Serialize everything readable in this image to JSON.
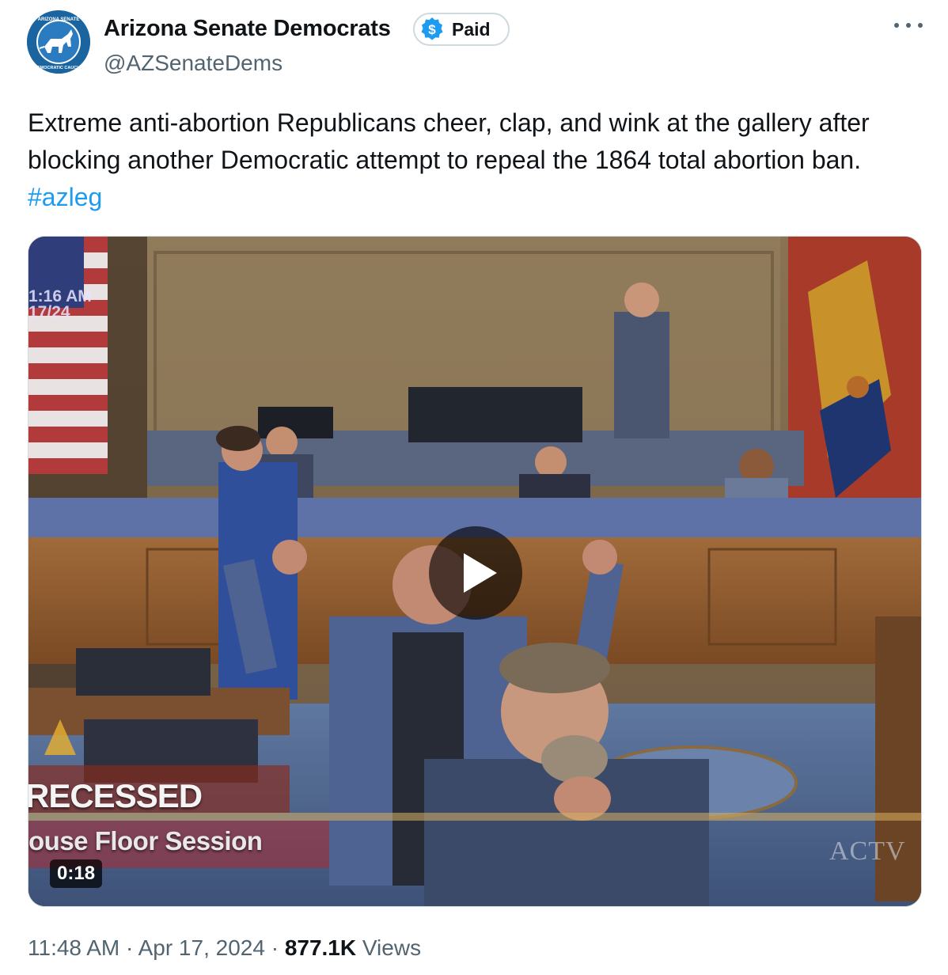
{
  "author": {
    "name": "Arizona Senate Democrats",
    "handle": "@AZSenateDems",
    "badge_label": "Paid",
    "avatar_text_top": "ARIZONA SENATE",
    "avatar_text_bottom": "DEMOCRATIC CAUCUS"
  },
  "tweet": {
    "text": "Extreme anti-abortion Republicans cheer, clap, and wink at the gallery after blocking another Democratic attempt to repeal the 1864 total abortion ban. ",
    "hashtag": "#azleg"
  },
  "media": {
    "duration": "0:18",
    "overlay_time": "1:16 AM",
    "overlay_date": "17/24",
    "overlay_status": "RECESSED",
    "overlay_session": "ouse Floor Session",
    "overlay_logo": "ACTV"
  },
  "meta": {
    "time": "11:48 AM",
    "date": "Apr 17, 2024",
    "views_count": "877.1K",
    "views_label": "Views"
  },
  "colors": {
    "link": "#1d9bf0",
    "secondary_text": "#536471",
    "badge_accent": "#1d9bf0"
  },
  "icons": [
    "more-icon",
    "dollar-icon",
    "play-icon"
  ]
}
